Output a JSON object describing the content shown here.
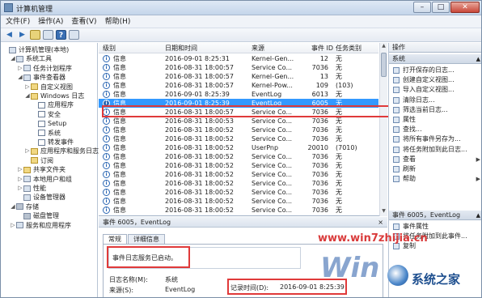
{
  "window": {
    "title": "计算机管理",
    "buttons": [
      "–",
      "□",
      "✕"
    ]
  },
  "menu": [
    "文件(F)",
    "操作(A)",
    "查看(V)",
    "帮助(H)"
  ],
  "tree": [
    {
      "label": "计算机管理(本地)",
      "exp": "",
      "icon": "computer-icon",
      "indent": 0
    },
    {
      "label": "系统工具",
      "exp": "◢",
      "icon": "tools-icon",
      "indent": 1
    },
    {
      "label": "任务计划程序",
      "exp": "▷",
      "icon": "clock-icon",
      "indent": 2
    },
    {
      "label": "事件查看器",
      "exp": "◢",
      "icon": "event-viewer-icon",
      "indent": 2
    },
    {
      "label": "自定义视图",
      "exp": "▷",
      "icon": "folder-icon",
      "indent": 3
    },
    {
      "label": "Windows 日志",
      "exp": "◢",
      "icon": "folder-icon",
      "indent": 3
    },
    {
      "label": "应用程序",
      "exp": "",
      "icon": "log-icon",
      "indent": 4
    },
    {
      "label": "安全",
      "exp": "",
      "icon": "log-icon",
      "indent": 4
    },
    {
      "label": "Setup",
      "exp": "",
      "icon": "log-icon",
      "indent": 4
    },
    {
      "label": "系统",
      "exp": "",
      "icon": "log-icon",
      "indent": 4
    },
    {
      "label": "转发事件",
      "exp": "",
      "icon": "log-icon",
      "indent": 4
    },
    {
      "label": "应用程序和服务日志",
      "exp": "▷",
      "icon": "folder-icon",
      "indent": 3
    },
    {
      "label": "订阅",
      "exp": "",
      "icon": "subscription-icon",
      "indent": 3
    },
    {
      "label": "共享文件夹",
      "exp": "▷",
      "icon": "shared-folder-icon",
      "indent": 2
    },
    {
      "label": "本地用户和组",
      "exp": "▷",
      "icon": "users-icon",
      "indent": 2
    },
    {
      "label": "性能",
      "exp": "▷",
      "icon": "performance-icon",
      "indent": 2
    },
    {
      "label": "设备管理器",
      "exp": "",
      "icon": "device-manager-icon",
      "indent": 2
    },
    {
      "label": "存储",
      "exp": "◢",
      "icon": "storage-icon",
      "indent": 1
    },
    {
      "label": "磁盘管理",
      "exp": "",
      "icon": "disk-icon",
      "indent": 2
    },
    {
      "label": "服务和应用程序",
      "exp": "▷",
      "icon": "services-icon",
      "indent": 1
    }
  ],
  "list": {
    "headers": [
      "级别",
      "日期和时间",
      "来源",
      "事件 ID",
      "任务类别"
    ],
    "rows": [
      [
        "信息",
        "2016-09-01 8:25:31",
        "Kernel-Gen...",
        "12",
        "无"
      ],
      [
        "信息",
        "2016-08-31 18:00:57",
        "Service Co...",
        "7036",
        "无"
      ],
      [
        "信息",
        "2016-08-31 18:00:57",
        "Kernel-Gen...",
        "13",
        "无"
      ],
      [
        "信息",
        "2016-08-31 18:00:57",
        "Kernel-Pow...",
        "109",
        "(103)"
      ],
      [
        "信息",
        "2016-09-01 8:25:39",
        "EventLog",
        "6013",
        "无"
      ],
      [
        "信息",
        "2016-09-01 8:25:39",
        "EventLog",
        "6005",
        "无"
      ],
      [
        "信息",
        "2016-08-31 18:00:57",
        "Service Co...",
        "7036",
        "无"
      ],
      [
        "信息",
        "2016-08-31 18:00:53",
        "Service Co...",
        "7036",
        "无"
      ],
      [
        "信息",
        "2016-08-31 18:00:52",
        "Service Co...",
        "7036",
        "无"
      ],
      [
        "信息",
        "2016-08-31 18:00:52",
        "Service Co...",
        "7036",
        "无"
      ],
      [
        "信息",
        "2016-08-31 18:00:52",
        "UserPnp",
        "20010",
        "(7010)"
      ],
      [
        "信息",
        "2016-08-31 18:00:52",
        "Service Co...",
        "7036",
        "无"
      ],
      [
        "信息",
        "2016-08-31 18:00:52",
        "Service Co...",
        "7036",
        "无"
      ],
      [
        "信息",
        "2016-08-31 18:00:52",
        "Service Co...",
        "7036",
        "无"
      ],
      [
        "信息",
        "2016-08-31 18:00:52",
        "Service Co...",
        "7036",
        "无"
      ],
      [
        "信息",
        "2016-08-31 18:00:52",
        "Service Co...",
        "7036",
        "无"
      ],
      [
        "信息",
        "2016-08-31 18:00:52",
        "Service Co...",
        "7036",
        "无"
      ],
      [
        "信息",
        "2016-08-31 18:00:52",
        "Service Co...",
        "7036",
        "无"
      ]
    ],
    "selected_index": 5
  },
  "detail": {
    "title": "事件 6005，EventLog",
    "close": "×",
    "tabs": [
      "常规",
      "详细信息"
    ],
    "message": "事件日志服务已启动。",
    "log_name_label": "日志名称(M):",
    "log_name_value": "系统",
    "source_label": "来源(S):",
    "source_value": "EventLog",
    "logged_label": "记录时间(D):",
    "logged_value": "2016-09-01 8:25:39"
  },
  "actions": {
    "header": "操作",
    "section1": "系统",
    "items1": [
      {
        "label": "打开保存的日志...",
        "icon": "open-log-icon",
        "arrow": ""
      },
      {
        "label": "创建自定义视图...",
        "icon": "create-view-icon",
        "arrow": ""
      },
      {
        "label": "导入自定义视图...",
        "icon": "import-view-icon",
        "arrow": ""
      },
      {
        "label": "清除日志...",
        "icon": "clear-log-icon",
        "arrow": ""
      },
      {
        "label": "筛选当前日志...",
        "icon": "filter-icon",
        "arrow": ""
      },
      {
        "label": "属性",
        "icon": "properties-icon",
        "arrow": ""
      },
      {
        "label": "查找...",
        "icon": "find-icon",
        "arrow": ""
      },
      {
        "label": "将所有事件另存为...",
        "icon": "save-icon",
        "arrow": ""
      },
      {
        "label": "将任务附加到此日志...",
        "icon": "attach-task-icon",
        "arrow": ""
      },
      {
        "label": "查看",
        "icon": "view-icon",
        "arrow": "▶"
      },
      {
        "label": "刷新",
        "icon": "refresh-icon",
        "arrow": ""
      },
      {
        "label": "帮助",
        "icon": "help-icon",
        "arrow": "▶"
      }
    ],
    "section2": "事件 6005，EventLog",
    "items2": [
      {
        "label": "事件属性",
        "icon": "event-properties-icon",
        "arrow": ""
      },
      {
        "label": "将任务附加到此事件...",
        "icon": "attach-task-icon",
        "arrow": ""
      },
      {
        "label": "复制",
        "icon": "copy-icon",
        "arrow": ""
      }
    ]
  },
  "watermark": {
    "url": "www.win7zhijia.cn",
    "win": "Win",
    "brand": "系统之家"
  }
}
